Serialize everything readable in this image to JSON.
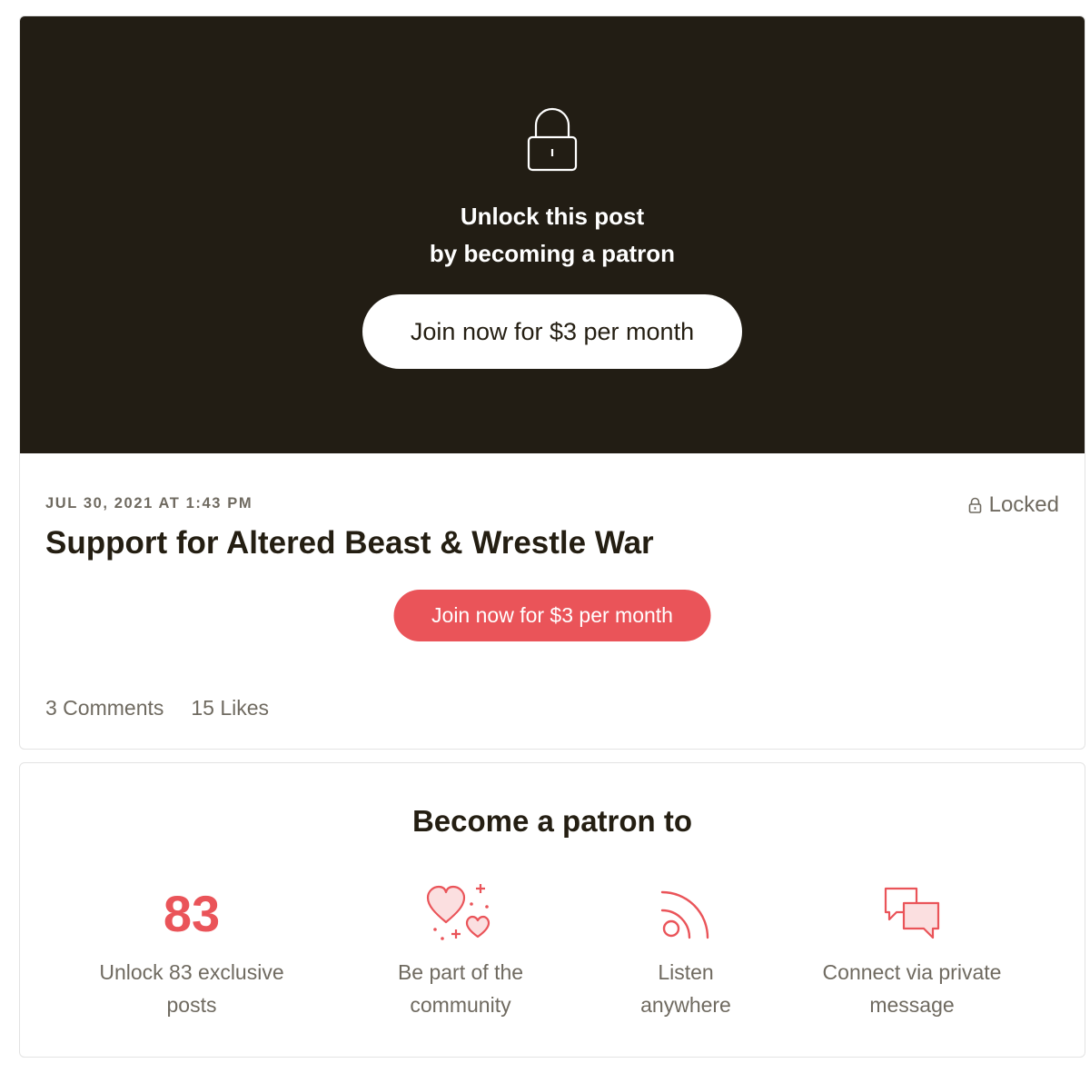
{
  "hero": {
    "line1": "Unlock this post",
    "line2": "by becoming a patron",
    "join_label": "Join now for $3 per month"
  },
  "post": {
    "date": "JUL 30, 2021 AT 1:43 PM",
    "status": "Locked",
    "title": "Support for Altered Beast & Wrestle War",
    "join_label": "Join now for $3 per month",
    "comments": "3 Comments",
    "likes": "15 Likes"
  },
  "benefits": {
    "title": "Become a patron to",
    "items": [
      {
        "count": "83",
        "line1": "Unlock 83 exclusive",
        "line2": "posts"
      },
      {
        "icon": "hearts-icon",
        "line1": "Be part of the",
        "line2": "community"
      },
      {
        "icon": "rss-icon",
        "line1": "Listen",
        "line2": "anywhere"
      },
      {
        "icon": "chat-bubbles-icon",
        "line1": "Connect via private",
        "line2": "message"
      }
    ]
  },
  "colors": {
    "hero_bg": "#221d14",
    "accent": "#ea5459",
    "text_dark": "#241e12",
    "text_muted": "#6f6a60"
  }
}
